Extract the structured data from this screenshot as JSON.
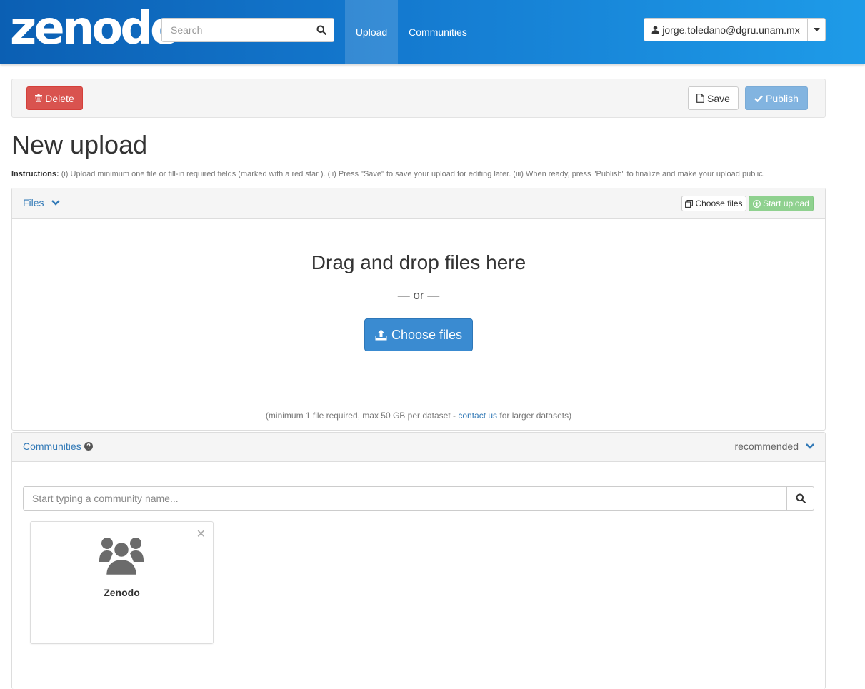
{
  "header": {
    "logo_text": "zenodo",
    "search_placeholder": "Search",
    "nav": {
      "upload": "Upload",
      "communities": "Communities"
    },
    "user_email": "jorge.toledano@dgru.unam.mx"
  },
  "toolbar": {
    "delete_label": "Delete",
    "save_label": "Save",
    "publish_label": "Publish"
  },
  "page": {
    "title": "New upload",
    "instructions_label": "Instructions:",
    "instructions_text": "(i) Upload minimum one file or fill-in required fields (marked with a red star ). (ii) Press \"Save\" to save your upload for editing later. (iii) When ready, press \"Publish\" to finalize and make your upload public."
  },
  "files_panel": {
    "title": "Files",
    "choose_files_small": "Choose files",
    "start_upload": "Start upload",
    "drop_title": "Drag and drop files here",
    "drop_or": "— or —",
    "choose_files_button": "Choose files",
    "note_prefix": "(minimum 1 file required, max 50 GB per dataset - ",
    "note_link": "contact us",
    "note_suffix": " for larger datasets)"
  },
  "communities_panel": {
    "title": "Communities",
    "recommended_label": "recommended",
    "search_placeholder": "Start typing a community name...",
    "cards": [
      {
        "name": "Zenodo"
      }
    ]
  },
  "icons": [
    "search-icon",
    "user-icon",
    "caret-down-icon",
    "trash-icon",
    "file-icon",
    "check-icon",
    "chevron-down-icon",
    "copy-icon",
    "upload-circle-icon",
    "upload-icon",
    "question-circle-icon",
    "close-icon",
    "users-icon"
  ],
  "colors": {
    "navbar_start": "#0b5fb3",
    "navbar_end": "#1e9be8",
    "delete": "#d9534f",
    "publish": "#82b4e0",
    "start_upload": "#8fd18f",
    "primary": "#3a8bd1",
    "link": "#337ab7"
  }
}
